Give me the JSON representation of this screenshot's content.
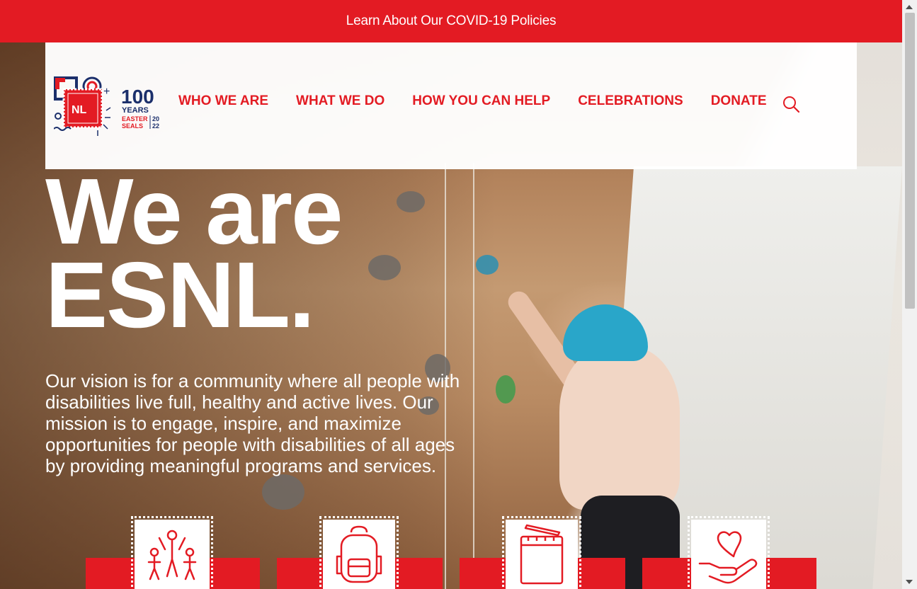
{
  "banner": {
    "text": "Learn About Our COVID-19 Policies"
  },
  "logo": {
    "badge": "NL",
    "years_number": "100",
    "years_word": "YEARS",
    "line1": "EASTER",
    "line2": "SEALS",
    "year_top": "20",
    "year_bottom": "22"
  },
  "nav": {
    "items": [
      "WHO WE ARE",
      "WHAT WE DO",
      "HOW YOU CAN HELP",
      "CELEBRATIONS",
      "DONATE"
    ]
  },
  "hero": {
    "headline_line1": "We are",
    "headline_line2": "ESNL.",
    "vision": "Our vision is for a community where all people with disabilities live full, healthy and active lives. Our mission is to engage, inspire, and maximize opportunities for people with disabilities of all ages by providing meaningful programs and services."
  },
  "icons": {
    "search": "search-icon",
    "cards": [
      "people-icon",
      "backpack-icon",
      "notepad-icon",
      "heart-hand-icon"
    ]
  },
  "colors": {
    "brand_red": "#e31b23",
    "navy": "#1b2f6b"
  }
}
